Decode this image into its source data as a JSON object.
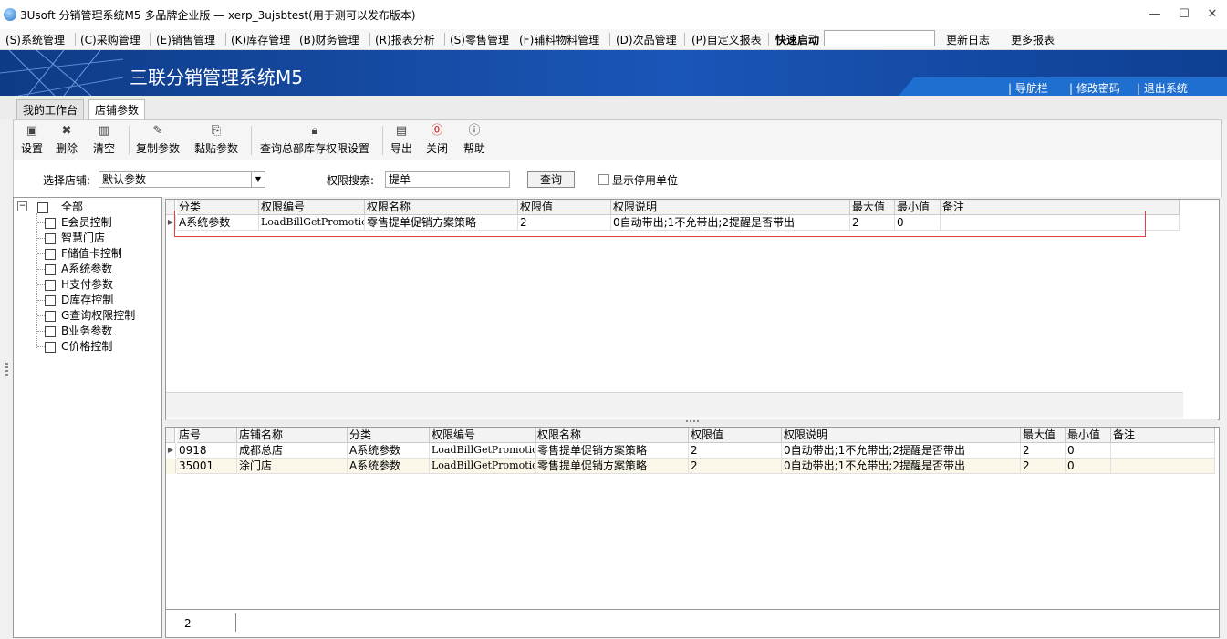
{
  "window": {
    "title": "3Usoft 分销管理系统M5 多品牌企业版 — xerp_3ujsbtest(用于测可以发布版本)",
    "controls": [
      "—",
      "☐",
      "✕"
    ]
  },
  "menubar": {
    "items": [
      "(S)系统管理",
      "(C)采购管理",
      "(E)销售管理",
      "(K)库存管理",
      "(B)财务管理",
      "(R)报表分析",
      "(S)零售管理",
      "(F)辅料物料管理",
      "(D)次品管理",
      "(P)自定义报表"
    ],
    "quick_label": "快速启动",
    "quick_value": "",
    "update_log": "更新日志",
    "more_reports": "更多报表"
  },
  "banner": {
    "title": "三联分销管理系统M5",
    "links": [
      "| 导航栏",
      "| 修改密码",
      "| 退出系统"
    ]
  },
  "tabs": [
    "我的工作台",
    "店铺参数"
  ],
  "toolbar": {
    "buttons": [
      {
        "label": "设置",
        "icon": "save-icon"
      },
      {
        "label": "删除",
        "icon": "delete-icon"
      },
      {
        "label": "清空",
        "icon": "clear-icon"
      },
      {
        "label": "复制参数",
        "icon": "copy-icon"
      },
      {
        "label": "黏贴参数",
        "icon": "paste-icon"
      },
      {
        "label": "查询总部库存权限设置",
        "icon": "lock-icon"
      },
      {
        "label": "导出",
        "icon": "export-icon"
      },
      {
        "label": "关闭",
        "icon": "close-icon"
      },
      {
        "label": "帮助",
        "icon": "help-icon"
      }
    ]
  },
  "filter": {
    "store_label": "选择店铺:",
    "store_value": "默认参数",
    "search_label": "权限搜索:",
    "search_value": "提单",
    "query_button": "查询",
    "show_disabled": "显示停用单位"
  },
  "tree": {
    "root": "全部",
    "items": [
      "E会员控制",
      "智慧门店",
      "F储值卡控制",
      "A系统参数",
      "H支付参数",
      "D库存控制",
      "G查询权限控制",
      "B业务参数",
      "C价格控制"
    ]
  },
  "top_grid": {
    "headers": [
      "分类",
      "权限编号",
      "权限名称",
      "权限值",
      "权限说明",
      "最大值",
      "最小值",
      "备注"
    ],
    "rows": [
      [
        "A系统参数",
        "LoadBillGetPromotion",
        "零售提单促销方案策略",
        "2",
        "0自动带出;1不允带出;2提醒是否带出",
        "2",
        "0",
        ""
      ]
    ]
  },
  "bottom_grid": {
    "headers": [
      "店号",
      "店铺名称",
      "分类",
      "权限编号",
      "权限名称",
      "权限值",
      "权限说明",
      "最大值",
      "最小值",
      "备注"
    ],
    "rows": [
      [
        "0918",
        "成都总店",
        "A系统参数",
        "LoadBillGetPromotion",
        "零售提单促销方案策略",
        "2",
        "0自动带出;1不允带出;2提醒是否带出",
        "2",
        "0",
        ""
      ],
      [
        "35001",
        "涂门店",
        "A系统参数",
        "LoadBillGetPromotion",
        "零售提单促销方案策略",
        "2",
        "0自动带出;1不允带出;2提醒是否带出",
        "2",
        "0",
        ""
      ]
    ],
    "footer_count": "2"
  },
  "colors": {
    "banner": "#1a56b8",
    "highlight_box": "#e04040",
    "alt_row": "#fbf8ea"
  }
}
